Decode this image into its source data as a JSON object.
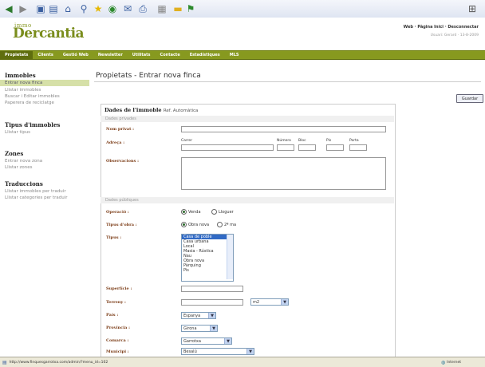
{
  "header": {
    "logo_small": "immo",
    "logo_big": "Dercantia",
    "toplinks": "Web  ·  Pàgina Inici  ·  Desconnectar",
    "userline": "Usuari: Gerard  ·  13-8-2009"
  },
  "nav": [
    "Propietats",
    "Clients",
    "Gestió Web",
    "Newsletter",
    "Utilitats",
    "Contacte",
    "Estadístiques",
    "MLS"
  ],
  "sidebar": {
    "immobles_title": "Immobles",
    "immobles_items": [
      "Entrar nova finca",
      "Llistar immobles",
      "Buscar i Editar immobles",
      "Paperera de reciclatge"
    ],
    "tipus_title": "Tipus d'immobles",
    "tipus_items": [
      "Llistar tipus"
    ],
    "zones_title": "Zones",
    "zones_items": [
      "Entrar nova zona",
      "Llistar zones"
    ],
    "trad_title": "Traduccions",
    "trad_items": [
      "Llistar immobles per traduir",
      "Llistar categories per traduir"
    ]
  },
  "main": {
    "page_title": "Propietats - Entrar nova finca",
    "save_label": "Guardar",
    "form_title": "Dades de l'immoble",
    "ref_label": "Ref. Automàtica",
    "section_private": "Dades privades",
    "nom_label": "Nom privat :",
    "adreca_label": "Adreça :",
    "carrer": "Carrer",
    "numero": "Número",
    "bloc": "Bloc",
    "pis": "Pis",
    "porta": "Porta",
    "observacions_label": "Observacions :",
    "section_public": "Dades públiques",
    "operacio_label": "Operació :",
    "op_venda": "Venda",
    "op_lloguer": "Lloguer",
    "tipus_obra_label": "Tipus d'obra :",
    "obra_nova": "Obra nova",
    "segona_ma": "2ª ma",
    "tipus_label": "Tipus :",
    "tipus_options": [
      "Casa de poble",
      "Casa urbana",
      "Local",
      "Masia - Rústica",
      "Nau",
      "Obra nova",
      "Pàrquing",
      "Pis"
    ],
    "superficie_label": "Superfície :",
    "terreny_label": "Terreny :",
    "terreny_unit": "m2",
    "pais_label": "País :",
    "pais_value": "Espanya",
    "provincia_label": "Província :",
    "provincia_value": "Girona",
    "comarca_label": "Comarca :",
    "comarca_value": "Garrotxa",
    "municipi_label": "Municipi :",
    "municipi_value": "Besalú"
  },
  "status": {
    "url": "http://www.finquesgarrotxa.com/admin/?menu_id=102",
    "zone": "Internet"
  }
}
